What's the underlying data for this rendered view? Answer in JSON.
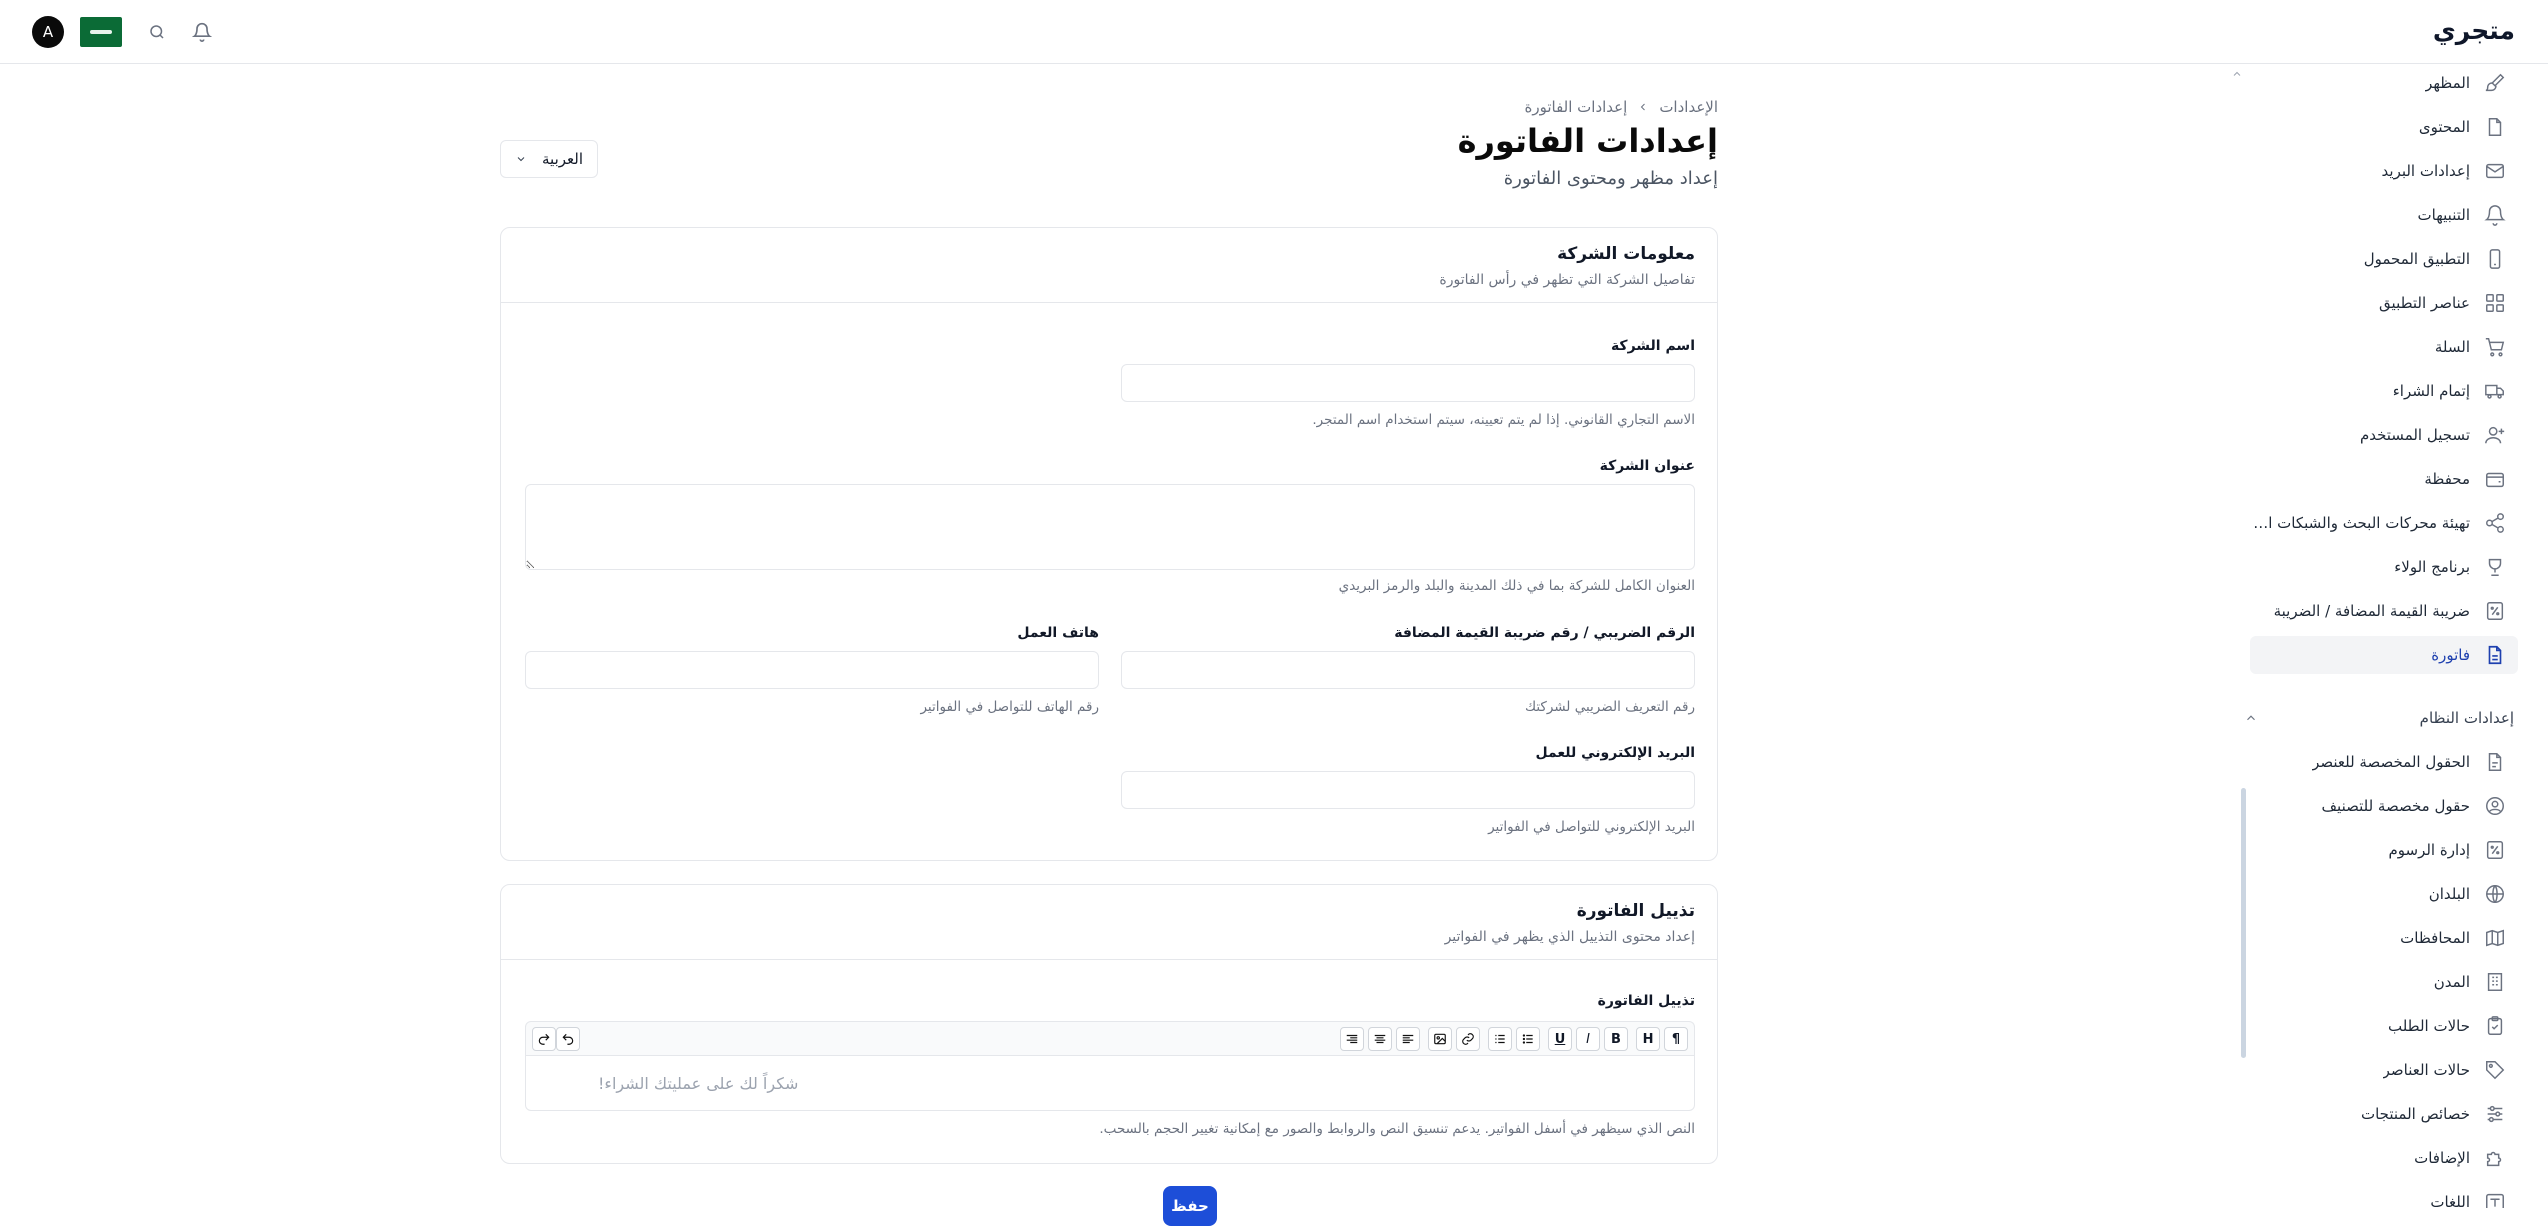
{
  "app": {
    "brand": "متجري",
    "avatar_letter": "A"
  },
  "header": {
    "search_icon": "search-icon",
    "bell_icon": "bell-icon",
    "flag_icon": "saudi-flag-icon"
  },
  "sidebar": {
    "items": [
      {
        "label": "المظهر",
        "icon": "brush-icon"
      },
      {
        "label": "المحتوى",
        "icon": "file-icon"
      },
      {
        "label": "إعدادات البريد",
        "icon": "mail-icon"
      },
      {
        "label": "التنبيهات",
        "icon": "bell-icon"
      },
      {
        "label": "التطبيق المحمول",
        "icon": "smartphone-icon"
      },
      {
        "label": "عناصر التطبيق",
        "icon": "grid-icon"
      },
      {
        "label": "السلة",
        "icon": "cart-icon"
      },
      {
        "label": "إتمام الشراء",
        "icon": "truck-icon"
      },
      {
        "label": "تسجيل المستخدم",
        "icon": "user-plus-icon"
      },
      {
        "label": "محفظة",
        "icon": "wallet-icon"
      },
      {
        "label": "تهيئة محركات البحث والشبكات الاجتما...",
        "icon": "share-icon"
      },
      {
        "label": "برنامج الولاء",
        "icon": "trophy-icon"
      },
      {
        "label": "ضريبة القيمة المضافة / الضريبة",
        "icon": "percent-icon"
      },
      {
        "label": "فاتورة",
        "icon": "invoice-icon",
        "active": true
      }
    ],
    "system_section": "إعدادات النظام",
    "system_items": [
      {
        "label": "الحقول المخصصة للعنصر",
        "icon": "file-text-icon"
      },
      {
        "label": "حقول مخصصة للتصنيف",
        "icon": "user-circle-icon"
      },
      {
        "label": "إدارة الرسوم",
        "icon": "percent-icon"
      },
      {
        "label": "البلدان",
        "icon": "globe-icon"
      },
      {
        "label": "المحافظات",
        "icon": "map-icon"
      },
      {
        "label": "المدن",
        "icon": "building-icon"
      },
      {
        "label": "حالات الطلب",
        "icon": "clipboard-icon"
      },
      {
        "label": "حالات العناصر",
        "icon": "tag-icon"
      },
      {
        "label": "خصائص المنتجات",
        "icon": "sliders-icon"
      },
      {
        "label": "الإضافات",
        "icon": "puzzle-icon"
      },
      {
        "label": "اللغات",
        "icon": "language-icon"
      }
    ]
  },
  "page": {
    "breadcrumb_root": "الإعدادات",
    "breadcrumb_current": "إعدادات الفاتورة",
    "title": "إعدادات الفاتورة",
    "subtitle": "إعداد مظهر ومحتوى الفاتورة",
    "language_select": "العربية"
  },
  "company_card": {
    "title": "معلومات الشركة",
    "desc": "تفاصيل الشركة التي تظهر في رأس الفاتورة",
    "name_label": "اسم الشركة",
    "name_value": "",
    "name_help": "الاسم التجاري القانوني. إذا لم يتم تعيينه، سيتم استخدام اسم المتجر.",
    "address_label": "عنوان الشركة",
    "address_value": "",
    "address_help": "العنوان الكامل للشركة بما في ذلك المدينة والبلد والرمز البريدي",
    "tax_label": "الرقم الضريبي / رقم ضريبة القيمة المضافة",
    "tax_value": "",
    "tax_help": "رقم التعريف الضريبي لشركتك",
    "phone_label": "هاتف العمل",
    "phone_value": "",
    "phone_help": "رقم الهاتف للتواصل في الفواتير",
    "email_label": "البريد الإلكتروني للعمل",
    "email_value": "",
    "email_help": "البريد الإلكتروني للتواصل في الفواتير"
  },
  "footer_card": {
    "title": "تذييل الفاتورة",
    "desc": "إعداد محتوى التذييل الذي يظهر في الفواتير",
    "editor_label": "تذييل الفاتورة",
    "editor_placeholder": "شكراً لك على عمليتك الشراء!",
    "editor_help": "النص الذي سيظهر في أسفل الفواتير. يدعم تنسيق النص والروابط والصور مع إمكانية تغيير الحجم بالسحب.",
    "toolbar": {
      "paragraph": "¶",
      "heading": "H",
      "bold": "B",
      "italic": "I",
      "underline": "U"
    }
  },
  "actions": {
    "save": "حفظ"
  },
  "colors": {
    "accent": "#1d4ed8",
    "active_bg": "#f3f4f6",
    "flag_green": "#0b6b36"
  }
}
